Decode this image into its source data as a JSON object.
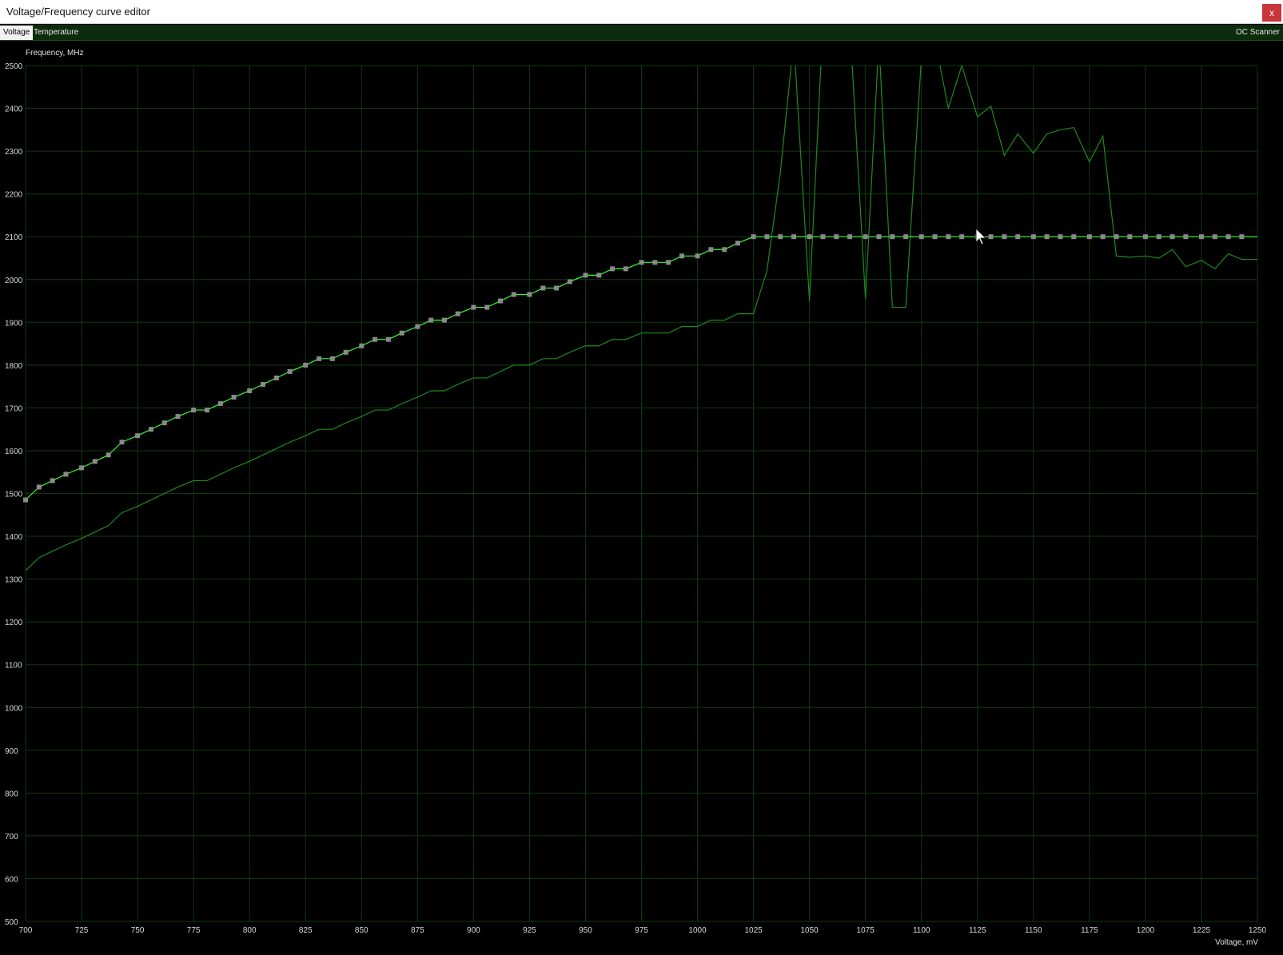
{
  "window": {
    "title": "Voltage/Frequency curve editor",
    "close_label": "x"
  },
  "tabs": [
    {
      "label": "Voltage",
      "active": true
    },
    {
      "label": "Temperature",
      "active": false
    }
  ],
  "oc_scanner_label": "OC Scanner",
  "colors": {
    "background": "#000000",
    "grid": "#0f3a0f",
    "curve": "#33ff33",
    "point": "#8a8a8a",
    "monitor": "#1e8c1e",
    "tabbar": "#0c2c0c",
    "close_button": "#c8353a"
  },
  "chart_data": {
    "type": "line",
    "xlabel": "Voltage, mV",
    "ylabel": "Frequency, MHz",
    "xlim": [
      700,
      1250
    ],
    "ylim": [
      500,
      2500
    ],
    "xticks": [
      700,
      725,
      750,
      775,
      800,
      825,
      850,
      875,
      900,
      925,
      950,
      975,
      1000,
      1025,
      1050,
      1075,
      1100,
      1125,
      1150,
      1175,
      1200,
      1225,
      1250
    ],
    "yticks": [
      500,
      600,
      700,
      800,
      900,
      1000,
      1100,
      1200,
      1300,
      1400,
      1500,
      1600,
      1700,
      1800,
      1900,
      2000,
      2100,
      2200,
      2300,
      2400,
      2500
    ],
    "grid": true,
    "series": [
      {
        "x": [
          700,
          706,
          712,
          718,
          725,
          731,
          737,
          743,
          750,
          756,
          762,
          768,
          775,
          781,
          787,
          793,
          800,
          806,
          812,
          818,
          825,
          831,
          837,
          843,
          850,
          856,
          862,
          868,
          875,
          881,
          887,
          893,
          900,
          906,
          912,
          918,
          925,
          931,
          937,
          943,
          950,
          956,
          962,
          968,
          975,
          981,
          987,
          993,
          1000,
          1006,
          1012,
          1018,
          1025,
          1031,
          1037,
          1043,
          1050,
          1056,
          1062,
          1068,
          1075,
          1081,
          1087,
          1093,
          1100,
          1106,
          1112,
          1118,
          1125,
          1131,
          1137,
          1143,
          1150,
          1156,
          1162,
          1168,
          1175,
          1181,
          1187,
          1193,
          1200,
          1206,
          1212,
          1218,
          1225,
          1231,
          1237,
          1243
        ],
        "y": [
          1485,
          1515,
          1530,
          1545,
          1560,
          1575,
          1590,
          1620,
          1635,
          1650,
          1665,
          1680,
          1695,
          1695,
          1710,
          1725,
          1740,
          1755,
          1770,
          1785,
          1800,
          1815,
          1815,
          1830,
          1845,
          1860,
          1860,
          1875,
          1890,
          1905,
          1905,
          1920,
          1935,
          1935,
          1950,
          1965,
          1965,
          1980,
          1980,
          1995,
          2010,
          2010,
          2025,
          2025,
          2040,
          2040,
          2040,
          2055,
          2055,
          2070,
          2070,
          2085,
          2100,
          2100,
          2100,
          2100,
          2100,
          2100,
          2100,
          2100,
          2100,
          2100,
          2100,
          2100,
          2100,
          2100,
          2100,
          2100,
          2100,
          2100,
          2100,
          2100,
          2100,
          2100,
          2100,
          2100,
          2100,
          2100,
          2100,
          2100,
          2100,
          2100,
          2100,
          2100,
          2100,
          2100,
          2100,
          2100
        ]
      },
      {
        "x": [
          700,
          706,
          712,
          718,
          725,
          731,
          737,
          743,
          750,
          756,
          762,
          768,
          775,
          781,
          787,
          793,
          800,
          806,
          812,
          818,
          825,
          831,
          837,
          843,
          850,
          856,
          862,
          868,
          875,
          881,
          887,
          893,
          900,
          906,
          912,
          918,
          925,
          931,
          937,
          943,
          950,
          956,
          962,
          968,
          975,
          981,
          987,
          993,
          1000,
          1006,
          1012,
          1018,
          1025,
          1031,
          1037,
          1043,
          1050,
          1056,
          1062,
          1068,
          1075,
          1081,
          1087,
          1093,
          1100,
          1106,
          1112,
          1118,
          1125,
          1131,
          1137,
          1143,
          1150,
          1156,
          1162,
          1168,
          1175,
          1181,
          1187,
          1193,
          1200,
          1206,
          1212,
          1218,
          1225,
          1231,
          1237,
          1243,
          1250
        ],
        "y": [
          1320,
          1350,
          1365,
          1380,
          1395,
          1410,
          1425,
          1455,
          1470,
          1485,
          1500,
          1515,
          1530,
          1530,
          1545,
          1560,
          1575,
          1590,
          1605,
          1620,
          1635,
          1650,
          1650,
          1665,
          1680,
          1695,
          1695,
          1710,
          1725,
          1740,
          1740,
          1755,
          1770,
          1770,
          1785,
          1800,
          1800,
          1815,
          1815,
          1830,
          1845,
          1845,
          1860,
          1860,
          1875,
          1875,
          1875,
          1890,
          1890,
          1905,
          1905,
          1920,
          1920,
          2020,
          2250,
          2560,
          1950,
          2600,
          2600,
          2600,
          1955,
          2560,
          1935,
          1935,
          2520,
          2560,
          2400,
          2500,
          2380,
          2405,
          2290,
          2340,
          2295,
          2340,
          2350,
          2355,
          2275,
          2335,
          2055,
          2052,
          2055,
          2050,
          2070,
          2030,
          2045,
          2025,
          2060,
          2047,
          2047
        ]
      }
    ]
  }
}
